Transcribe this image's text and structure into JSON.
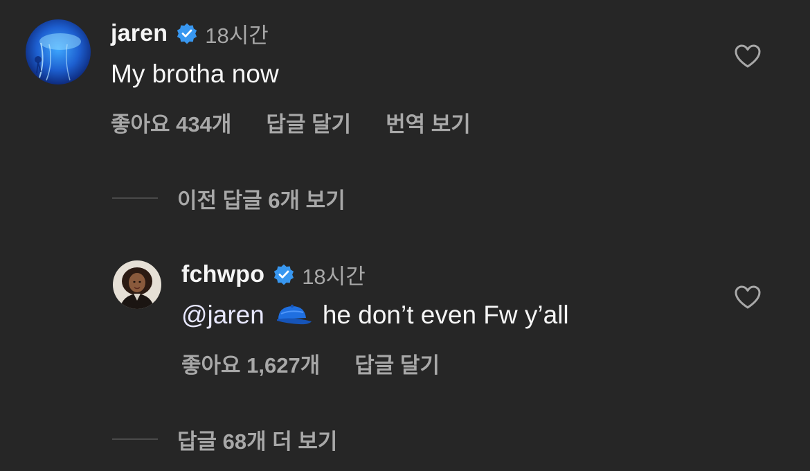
{
  "comment": {
    "username": "jaren",
    "verified": true,
    "time": "18시간",
    "text": "My brotha now",
    "likes_label": "좋아요 434개",
    "reply_label": "답글 달기",
    "translate_label": "번역 보기",
    "icons": {
      "avatar": "jellyfish-avatar",
      "badge": "verified-badge-icon",
      "like": "heart-outline-icon"
    }
  },
  "previous_replies": {
    "label": "이전 답글 6개 보기"
  },
  "reply": {
    "username": "fchwpo",
    "verified": true,
    "time": "18시간",
    "mention": "@jaren",
    "emoji": "blue-cap-emoji",
    "text": "he don’t even Fw y’all",
    "likes_label": "좋아요 1,627개",
    "reply_label": "답글 달기",
    "icons": {
      "avatar": "portrait-avatar",
      "badge": "verified-badge-icon",
      "like": "heart-outline-icon"
    }
  },
  "more_replies": {
    "label": "답글 68개 더 보기"
  },
  "colors": {
    "background": "#262626",
    "primary_text": "#f5f5f5",
    "secondary_text": "#a8a8a8",
    "verified_blue": "#3897f0",
    "divider": "#4a4a4a"
  }
}
